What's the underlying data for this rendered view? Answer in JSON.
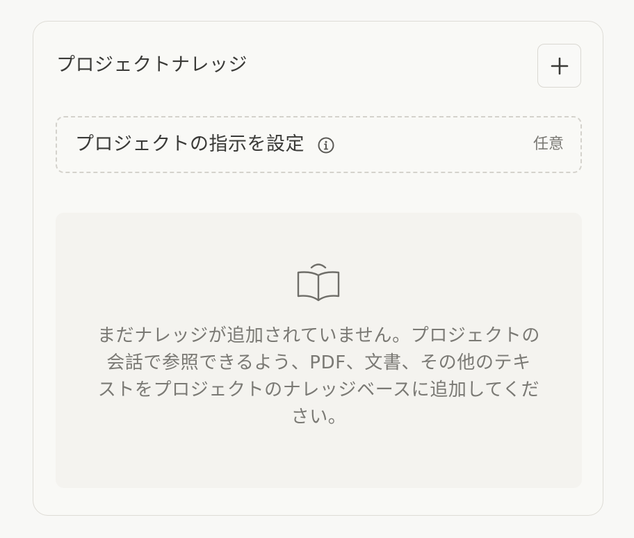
{
  "panel": {
    "title": "プロジェクトナレッジ",
    "add_button_icon": "plus-icon"
  },
  "instructions": {
    "label": "プロジェクトの指示を設定",
    "info_icon": "info-icon",
    "optional": "任意"
  },
  "empty_state": {
    "icon": "book-icon",
    "lines": [
      "まだナレッジが追加されていません。プロジェクトの",
      "会話で参照できるよう、PDF、文書、その他のテキ",
      "ストをプロジェクトのナレッジベースに追加してくだ",
      "さい。"
    ]
  },
  "colors": {
    "background": "#f8f8f6",
    "border": "#dedcd6",
    "text_primary": "#3a3a37",
    "text_muted": "#7a7974",
    "empty_bg": "#f4f3ef"
  }
}
